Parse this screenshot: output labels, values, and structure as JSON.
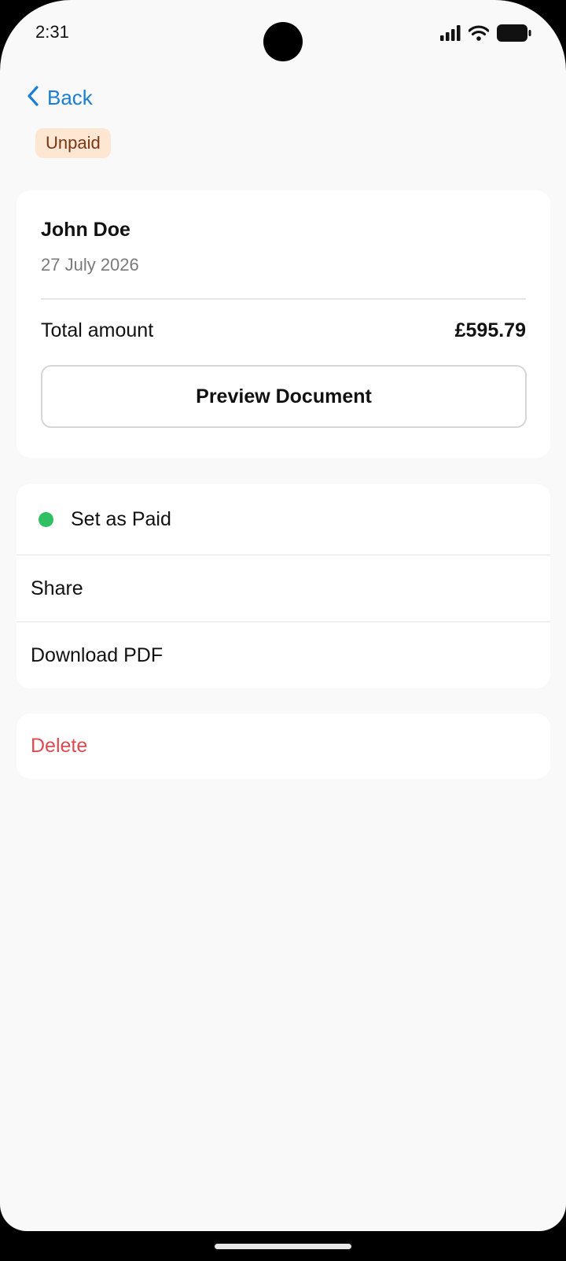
{
  "status_bar": {
    "time": "2:31",
    "icons": [
      "cellular-signal-icon",
      "wifi-icon",
      "battery-icon"
    ]
  },
  "nav": {
    "back_label": "Back",
    "back_icon": "chevron-left-icon",
    "accent_color": "#1a7fd4"
  },
  "badge": {
    "status": "Unpaid",
    "bg_color": "#fde7d2",
    "text_color": "#7a3515"
  },
  "summary": {
    "customer_name": "John Doe",
    "date": "27 July 2026",
    "total_label": "Total amount",
    "total_value": "£595.79",
    "preview_button": "Preview Document"
  },
  "actions": {
    "set_paid": "Set as Paid",
    "set_paid_dot_color": "#2ec063",
    "share": "Share",
    "download": "Download PDF"
  },
  "danger": {
    "delete": "Delete",
    "color": "#dd4b50"
  }
}
